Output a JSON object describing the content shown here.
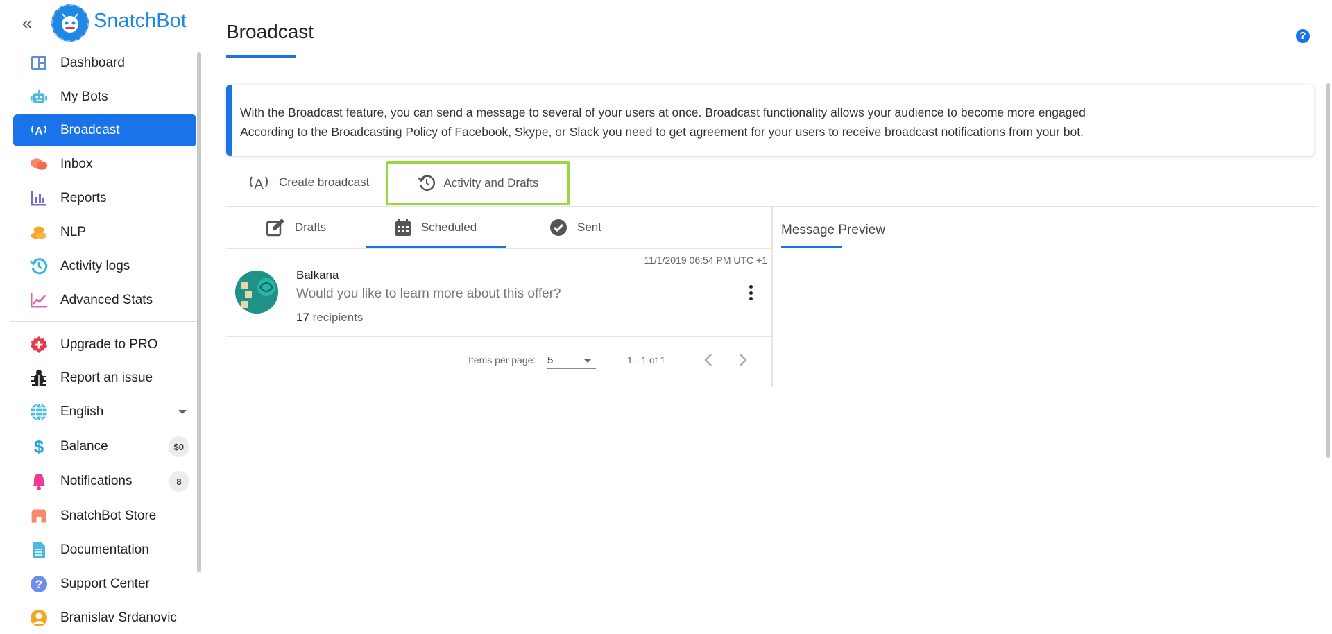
{
  "brand": {
    "name": "SnatchBot"
  },
  "sidebar": {
    "collapse_icon": "double-chevron-left-icon",
    "items": [
      {
        "label": "Dashboard",
        "icon": "dashboard-icon"
      },
      {
        "label": "My Bots",
        "icon": "robot-icon"
      },
      {
        "label": "Broadcast",
        "icon": "broadcast-icon",
        "active": true
      },
      {
        "label": "Inbox",
        "icon": "chat-bubbles-icon"
      },
      {
        "label": "Reports",
        "icon": "bar-chart-icon"
      },
      {
        "label": "NLP",
        "icon": "coins-icon"
      },
      {
        "label": "Activity logs",
        "icon": "history-icon"
      },
      {
        "label": "Advanced Stats",
        "icon": "line-chart-icon"
      },
      {
        "label": "Upgrade to PRO",
        "icon": "plus-badge-icon"
      },
      {
        "label": "Report an issue",
        "icon": "bug-icon"
      },
      {
        "label": "English",
        "icon": "globe-icon"
      },
      {
        "label": "Balance",
        "icon": "dollar-icon",
        "badge": "$0"
      },
      {
        "label": "Notifications",
        "icon": "bell-icon",
        "badge": "8"
      },
      {
        "label": "SnatchBot Store",
        "icon": "store-icon"
      },
      {
        "label": "Documentation",
        "icon": "document-icon"
      },
      {
        "label": "Support Center",
        "icon": "question-icon"
      },
      {
        "label": "Branislav Srdanovic",
        "icon": "user-icon"
      }
    ]
  },
  "page": {
    "title": "Broadcast",
    "info_line1": "With the Broadcast feature, you can send a message to several of your users at once. Broadcast functionality allows your audience to become more engaged",
    "info_line2": "According to the Broadcasting Policy of Facebook, Skype, or Slack you need to get agreement for your users to receive broadcast notifications from your bot."
  },
  "main_tabs": {
    "create": "Create broadcast",
    "activity": "Activity and Drafts"
  },
  "sub_tabs": {
    "drafts": "Drafts",
    "scheduled": "Scheduled",
    "sent": "Sent",
    "selected": "Scheduled"
  },
  "messages": [
    {
      "date": "11/1/2019 06:54 PM UTC +1",
      "name": "Balkana",
      "text": "Would you like to learn more about this offer?",
      "recipient_count": "17",
      "recipient_label": "recipients"
    }
  ],
  "pagination": {
    "items_per_page_label": "Items per page:",
    "items_per_page": "5",
    "range": "1 - 1 of 1"
  },
  "preview": {
    "title": "Message Preview"
  },
  "colors": {
    "accent": "#1a73e8",
    "highlight_outline": "#97d93a"
  }
}
